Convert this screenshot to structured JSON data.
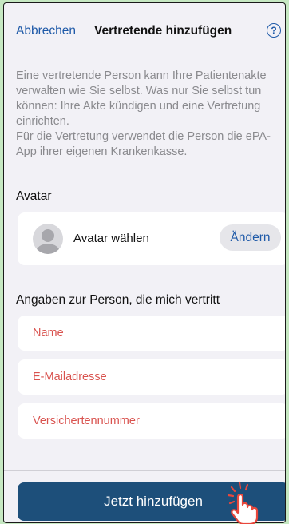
{
  "header": {
    "cancel_label": "Abbrechen",
    "title": "Vertretende hinzufügen",
    "help_icon": "?"
  },
  "intro": {
    "paragraph1": "Eine vertretende Person kann Ihre Patientenakte verwalten wie Sie selbst. Was nur Sie selbst tun können: Ihre Akte kündigen und eine Vertretung einrichten.",
    "paragraph2": "Für die Vertretung verwendet die Person die ePA-App ihrer eigenen Krankenkasse."
  },
  "avatar_section": {
    "title": "Avatar",
    "label": "Avatar wählen",
    "change_label": "Ändern"
  },
  "person_section": {
    "title": "Angaben zur Person, die mich vertritt",
    "fields": [
      {
        "placeholder": "Name"
      },
      {
        "placeholder": "E-Mailadresse"
      },
      {
        "placeholder": "Versichertennummer"
      }
    ]
  },
  "actions": {
    "primary_label": "Jetzt hinzufügen"
  },
  "colors": {
    "background": "#c6e8c2",
    "accent": "#1f5aa8",
    "field_label": "#d9534f",
    "primary_button": "#1d4f7a"
  }
}
